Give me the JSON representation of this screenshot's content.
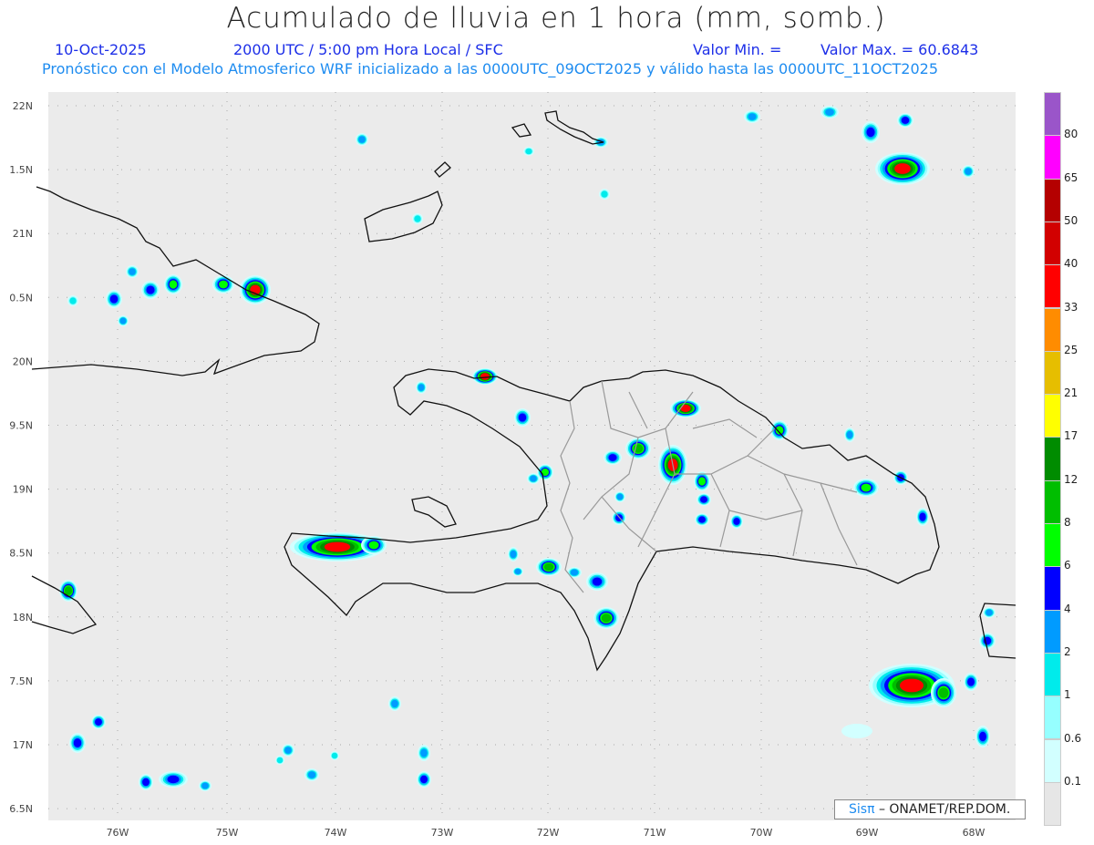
{
  "header": {
    "title": "Acumulado de lluvia en 1 hora (mm, somb.)",
    "date": "10-Oct-2025",
    "time": "2000 UTC / 5:00 pm Hora Local / SFC",
    "min_label": "Valor Min. =",
    "max_label": "Valor Max. = 60.6843",
    "subtitle": "Pronóstico con el Modelo Atmosferico WRF inicializado a las 0000UTC_09OCT2025 y válido hasta las  0000UTC_11OCT2025"
  },
  "axes": {
    "lon_labels": [
      "76W",
      "75W",
      "74W",
      "73W",
      "72W",
      "71W",
      "70W",
      "69W",
      "68W"
    ],
    "lat_labels": [
      "22N",
      "1.5N",
      "21N",
      "0.5N",
      "20N",
      "9.5N",
      "19N",
      "8.5N",
      "18N",
      "7.5N",
      "17N",
      "6.5N"
    ]
  },
  "colorbar": {
    "colors": [
      "#9a55c9",
      "#ff00ff",
      "#b40000",
      "#d20000",
      "#ff0000",
      "#ff8c00",
      "#e6be00",
      "#ffff00",
      "#008c00",
      "#00be00",
      "#00ff00",
      "#0000ff",
      "#009bff",
      "#00ebeb",
      "#96ffff",
      "#d2ffff",
      "#e6e6e6"
    ],
    "labels": [
      "80",
      "65",
      "50",
      "40",
      "33",
      "25",
      "21",
      "17",
      "12",
      "8",
      "6",
      "4",
      "2",
      "1",
      "0.6",
      "0.1"
    ]
  },
  "credit": {
    "brand": "Sisπ",
    "org": "– ONAMET/REP.DOM."
  }
}
